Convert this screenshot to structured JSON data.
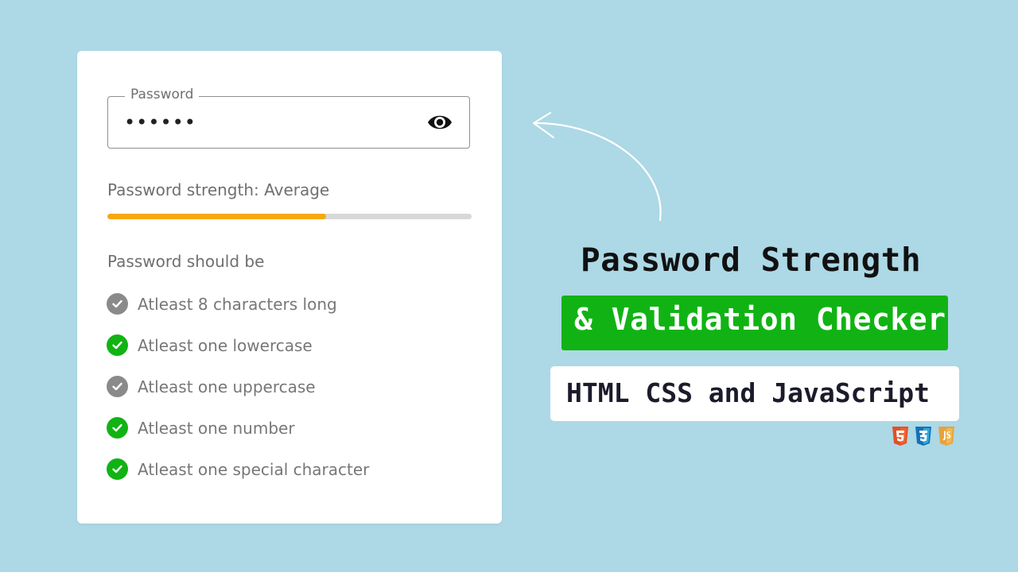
{
  "form": {
    "password_label": "Password",
    "password_value": "aB3$xy",
    "toggle_icon": "eye-icon",
    "strength_text": "Password strength: Average",
    "strength_level": 0.6,
    "strength_color": "#f5a90f",
    "requirements_title": "Password should be",
    "requirements": [
      {
        "text": "Atleast 8 characters long",
        "met": false
      },
      {
        "text": "Atleast one lowercase",
        "met": true
      },
      {
        "text": "Atleast one uppercase",
        "met": false
      },
      {
        "text": "Atleast one number",
        "met": true
      },
      {
        "text": "Atleast one special character",
        "met": true
      }
    ],
    "met_color": "#11b314",
    "unmet_color": "#8a8a8a"
  },
  "banner": {
    "title": "Password Strength",
    "subtitle": "& Validation Checker",
    "tech": "HTML CSS and JavaScript",
    "accent_color": "#11b314",
    "background_color": "#add8e6",
    "tech_icons": [
      "html5-icon",
      "css3-icon",
      "javascript-icon"
    ]
  }
}
